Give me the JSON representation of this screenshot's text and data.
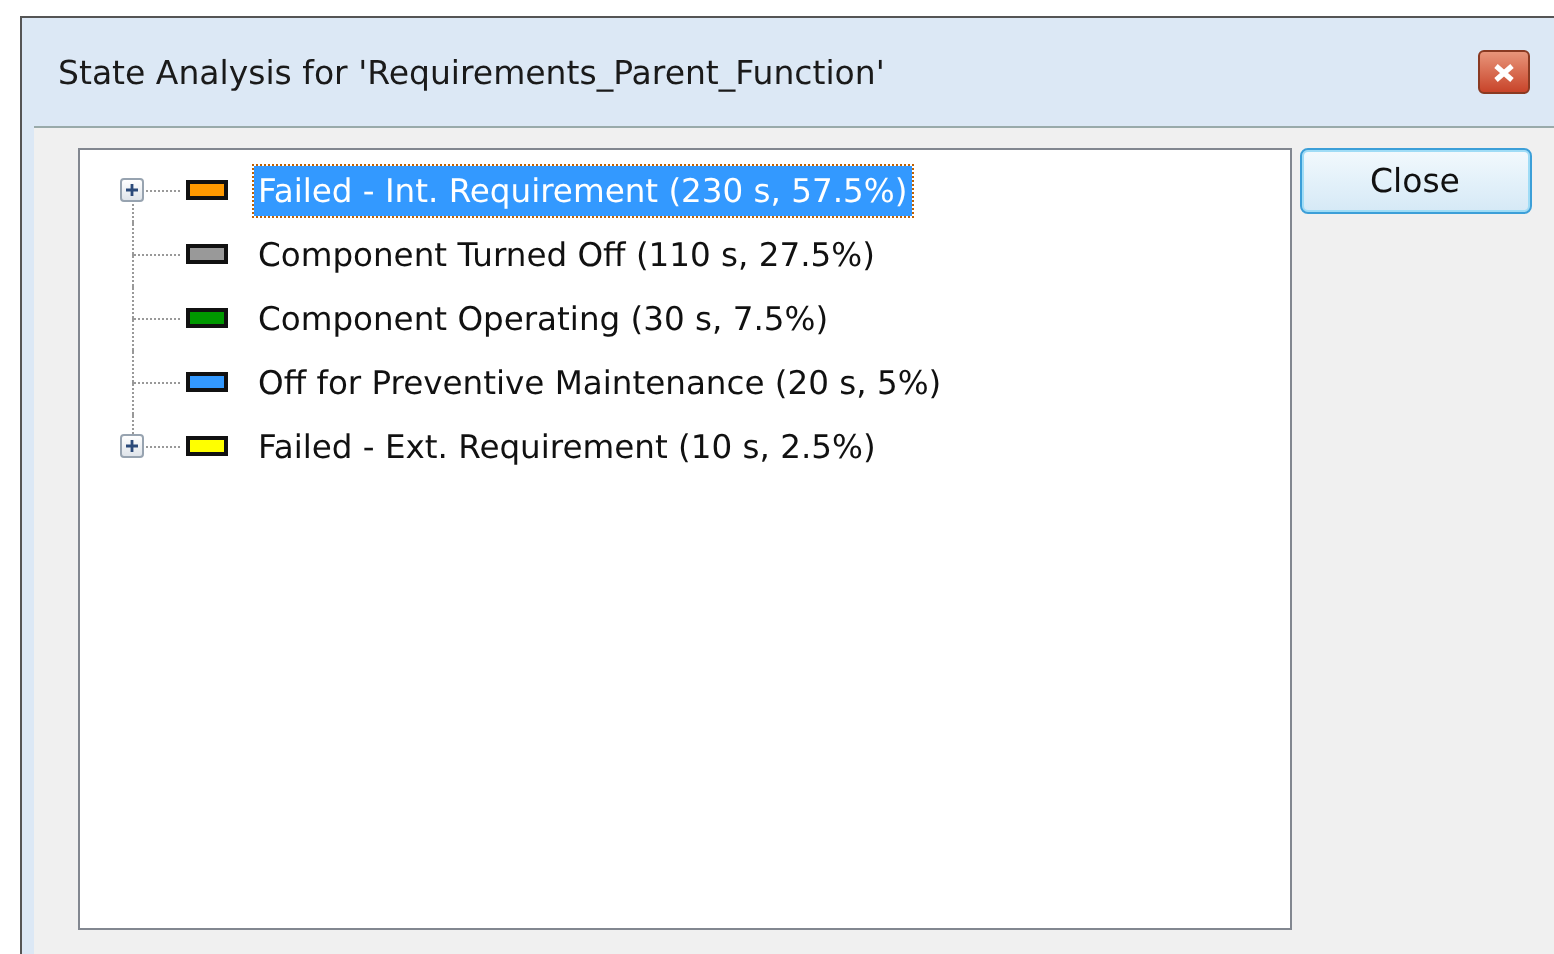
{
  "window": {
    "title": "State Analysis for 'Requirements_Parent_Function'"
  },
  "tree": {
    "items": [
      {
        "label": "Failed - Int. Requirement (230 s, 57.5%)",
        "color": "#ff9900",
        "selected": true,
        "expanded": false
      },
      {
        "label": "Component Turned Off (110 s, 27.5%)",
        "color": "#999999",
        "selected": false
      },
      {
        "label": "Component Operating (30 s, 7.5%)",
        "color": "#009900",
        "selected": false
      },
      {
        "label": "Off for Preventive Maintenance (20 s, 5%)",
        "color": "#3399ff",
        "selected": false
      },
      {
        "label": "Failed - Ext. Requirement (10 s, 2.5%)",
        "color": "#ffff00",
        "selected": false,
        "expanded": false
      }
    ]
  },
  "buttons": [
    {
      "label": "Close"
    }
  ]
}
